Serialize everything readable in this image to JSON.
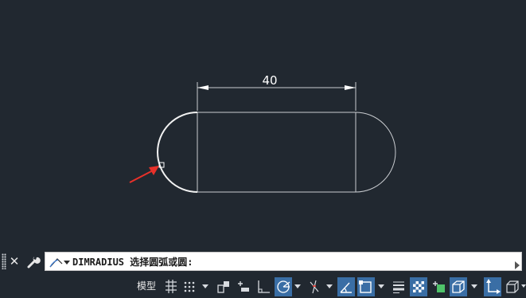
{
  "drawing": {
    "dimension_text": "40",
    "colors": {
      "background": "#212830",
      "lines": "#c9ccd0",
      "highlight_arc": "#f2f2f2",
      "arrow": "#e8312a"
    }
  },
  "command_line": {
    "close_icon": "close-icon",
    "customize_icon": "wrench-icon",
    "command_icon": "command-prompt-icon",
    "prompt_text": "DIMRADIUS 选择圆弧或圆:"
  },
  "status_bar": {
    "model_label": "模型",
    "buttons": [
      {
        "name": "grid-display",
        "icon": "grid-icon",
        "active": false
      },
      {
        "name": "snap-mode",
        "icon": "snap-dots-icon",
        "active": false
      },
      {
        "name": "infer-constraints",
        "icon": "infer-constraints-icon",
        "active": false
      },
      {
        "name": "dynamic-input",
        "icon": "dynamic-input-icon",
        "active": false
      },
      {
        "name": "ortho-mode",
        "icon": "ortho-icon",
        "active": false
      },
      {
        "name": "polar-tracking",
        "icon": "polar-tracking-icon",
        "active": true
      },
      {
        "name": "isodraft",
        "icon": "isodraft-icon",
        "active": false
      },
      {
        "name": "object-snap-tracking",
        "icon": "object-snap-tracking-icon",
        "active": true
      },
      {
        "name": "object-snap",
        "icon": "object-snap-icon",
        "active": true
      },
      {
        "name": "lineweight",
        "icon": "lineweight-icon",
        "active": false
      },
      {
        "name": "transparency",
        "icon": "transparency-icon",
        "active": true
      },
      {
        "name": "selection-cycling",
        "icon": "selection-cycling-icon",
        "active": false
      },
      {
        "name": "3d-object-snap",
        "icon": "3d-object-snap-icon",
        "active": true
      },
      {
        "name": "dynamic-ucs",
        "icon": "dynamic-ucs-icon",
        "active": true
      },
      {
        "name": "selection-filter",
        "icon": "selection-filter-icon",
        "active": false
      }
    ]
  }
}
